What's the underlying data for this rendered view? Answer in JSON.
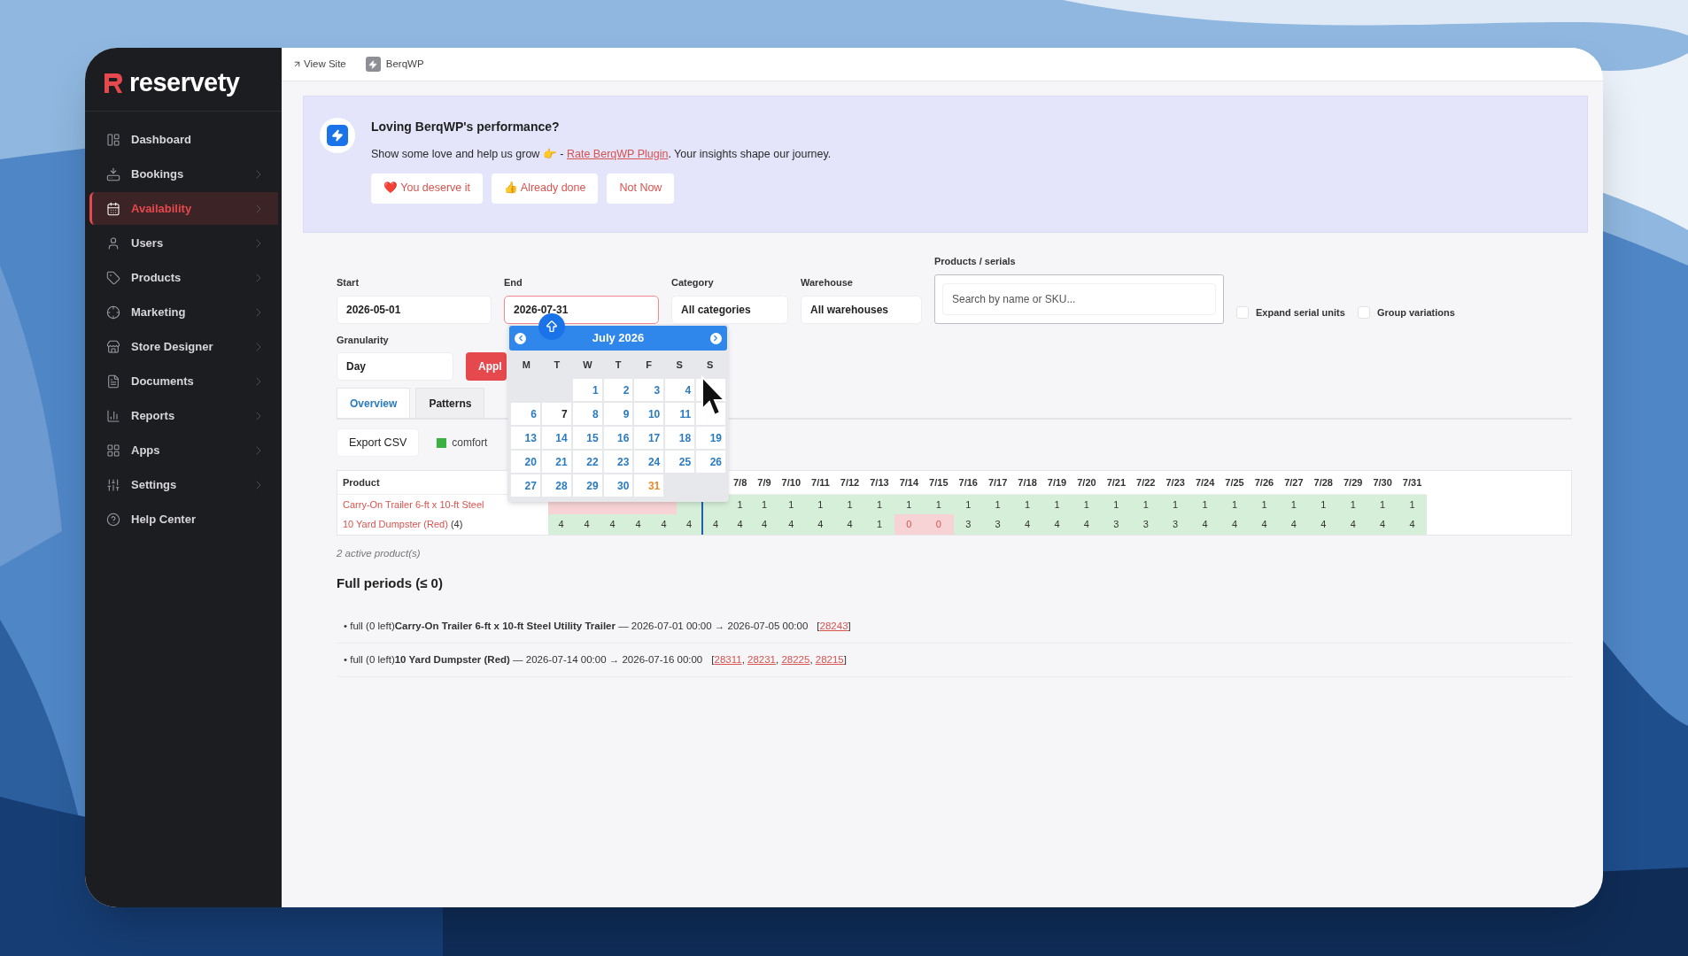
{
  "brand": {
    "name": "reservety"
  },
  "sidebar": {
    "items": [
      {
        "label": "Dashboard",
        "selected": false,
        "has_submenu": false
      },
      {
        "label": "Bookings",
        "selected": false,
        "has_submenu": true
      },
      {
        "label": "Availability",
        "selected": true,
        "has_submenu": true
      },
      {
        "label": "Users",
        "selected": false,
        "has_submenu": true
      },
      {
        "label": "Products",
        "selected": false,
        "has_submenu": true
      },
      {
        "label": "Marketing",
        "selected": false,
        "has_submenu": true
      },
      {
        "label": "Store Designer",
        "selected": false,
        "has_submenu": true
      },
      {
        "label": "Documents",
        "selected": false,
        "has_submenu": true
      },
      {
        "label": "Reports",
        "selected": false,
        "has_submenu": true
      },
      {
        "label": "Apps",
        "selected": false,
        "has_submenu": true
      },
      {
        "label": "Settings",
        "selected": false,
        "has_submenu": true
      },
      {
        "label": "Help Center",
        "selected": false,
        "has_submenu": false
      }
    ]
  },
  "topbar": {
    "links": [
      "View Site",
      "BerqWP"
    ]
  },
  "notice": {
    "title": "Loving BerqWP's performance?",
    "text_before": "Show some love and help us grow 👉 - ",
    "link": "Rate BerqWP Plugin",
    "text_after": ". Your insights shape our journey.",
    "buttons": [
      "❤️ You deserve it",
      "👍 Already done",
      "Not Now"
    ]
  },
  "filters": {
    "start": {
      "label": "Start",
      "value": "2026-05-01"
    },
    "end": {
      "label": "End",
      "value": "2026-07-31",
      "focused": true
    },
    "category": {
      "label": "Category",
      "value": "All categories"
    },
    "warehouse": {
      "label": "Warehouse",
      "value": "All warehouses"
    },
    "products": {
      "label": "Products / serials",
      "placeholder": "Search by name or SKU..."
    },
    "options": [
      {
        "label": "Expand serial units",
        "checked": false
      },
      {
        "label": "Group variations",
        "checked": false
      }
    ],
    "granularity": {
      "label": "Granularity",
      "value": "Day"
    },
    "apply": "Appl"
  },
  "tabs": [
    {
      "label": "Overview",
      "selected": true
    },
    {
      "label": "Patterns",
      "selected": false
    }
  ],
  "export": "Export CSV",
  "legend": [
    {
      "label": "comfort",
      "color": "#3cb043"
    }
  ],
  "table": {
    "product_header": "Product",
    "columns": [
      {
        "today": false
      },
      {
        "today": false
      },
      {
        "today": false
      },
      {
        "today": false
      },
      {
        "today": false
      },
      {
        "today": false
      },
      {
        "today": true
      },
      {
        "label": "7/8",
        "today": false
      },
      {
        "label": "7/9",
        "today": false
      },
      {
        "label": "7/10",
        "today": false
      },
      {
        "label": "7/11",
        "today": false
      },
      {
        "label": "7/12",
        "today": false
      },
      {
        "label": "7/13",
        "today": false
      },
      {
        "label": "7/14",
        "today": false
      },
      {
        "label": "7/15",
        "today": false
      },
      {
        "label": "7/16",
        "today": false
      },
      {
        "label": "7/17",
        "today": false
      },
      {
        "label": "7/18",
        "today": false
      },
      {
        "label": "7/19",
        "today": false
      },
      {
        "label": "7/20",
        "today": false
      },
      {
        "label": "7/21",
        "today": false
      },
      {
        "label": "7/22",
        "today": false
      },
      {
        "label": "7/23",
        "today": false
      },
      {
        "label": "7/24",
        "today": false
      },
      {
        "label": "7/25",
        "today": false
      },
      {
        "label": "7/26",
        "today": false
      },
      {
        "label": "7/27",
        "today": false
      },
      {
        "label": "7/28",
        "today": false
      },
      {
        "label": "7/29",
        "today": false
      },
      {
        "label": "7/30",
        "today": false
      },
      {
        "label": "7/31",
        "today": false
      }
    ],
    "rows": [
      {
        "name": "Carry-On Trailer 6-ft x 10-ft Steel",
        "cells": [
          {
            "full": true
          },
          {
            "full": true
          },
          {
            "full": true
          },
          {
            "full": true
          },
          {
            "full": true
          },
          {
            "full": false
          },
          {
            "full": false
          },
          {
            "value": "1",
            "full": false
          },
          {
            "value": "1",
            "full": false
          },
          {
            "value": "1",
            "full": false
          },
          {
            "value": "1",
            "full": false
          },
          {
            "value": "1",
            "full": false
          },
          {
            "value": "1",
            "full": false
          },
          {
            "value": "1",
            "full": false
          },
          {
            "value": "1",
            "full": false
          },
          {
            "value": "1",
            "full": false
          },
          {
            "value": "1",
            "full": false
          },
          {
            "value": "1",
            "full": false
          },
          {
            "value": "1",
            "full": false
          },
          {
            "value": "1",
            "full": false
          },
          {
            "value": "1",
            "full": false
          },
          {
            "value": "1",
            "full": false
          },
          {
            "value": "1",
            "full": false
          },
          {
            "value": "1",
            "full": false
          },
          {
            "value": "1",
            "full": false
          },
          {
            "value": "1",
            "full": false
          },
          {
            "value": "1",
            "full": false
          },
          {
            "value": "1",
            "full": false
          },
          {
            "value": "1",
            "full": false
          },
          {
            "value": "1",
            "full": false
          },
          {
            "value": "1",
            "full": false
          }
        ]
      },
      {
        "name": "10 Yard Dumpster (Red)",
        "count": "(4)",
        "cells": [
          {
            "value": "4",
            "full": false
          },
          {
            "value": "4",
            "full": false
          },
          {
            "value": "4",
            "full": false
          },
          {
            "value": "4",
            "full": false
          },
          {
            "value": "4",
            "full": false
          },
          {
            "value": "4",
            "full": false
          },
          {
            "value": "4",
            "full": false
          },
          {
            "value": "4",
            "full": false
          },
          {
            "value": "4",
            "full": false
          },
          {
            "value": "4",
            "full": false
          },
          {
            "value": "4",
            "full": false
          },
          {
            "value": "4",
            "full": false
          },
          {
            "value": "1",
            "full": false
          },
          {
            "value": "0",
            "full": true
          },
          {
            "value": "0",
            "full": true
          },
          {
            "value": "3",
            "full": false
          },
          {
            "value": "3",
            "full": false
          },
          {
            "value": "4",
            "full": false
          },
          {
            "value": "4",
            "full": false
          },
          {
            "value": "4",
            "full": false
          },
          {
            "value": "3",
            "full": false
          },
          {
            "value": "3",
            "full": false
          },
          {
            "value": "3",
            "full": false
          },
          {
            "value": "4",
            "full": false
          },
          {
            "value": "4",
            "full": false
          },
          {
            "value": "4",
            "full": false
          },
          {
            "value": "4",
            "full": false
          },
          {
            "value": "4",
            "full": false
          },
          {
            "value": "4",
            "full": false
          },
          {
            "value": "4",
            "full": false
          },
          {
            "value": "4",
            "full": false
          }
        ]
      }
    ]
  },
  "active_count": "2 active product(s)",
  "full_periods": {
    "title": "Full periods (≤ 0)",
    "open": "[",
    "close": "]",
    "separator": ", ",
    "entries": [
      {
        "text": "• full (0 left)**Carry-On Trailer 6-ft x 10-ft Steel Utility Trailer** — 2026-07-01 00:00 → 2026-07-05 00:00",
        "bookings": [
          "28243"
        ]
      },
      {
        "text": "• full (0 left)**10 Yard Dumpster (Red)** — 2026-07-14 00:00 → 2026-07-16 00:00",
        "bookings": [
          "28311",
          "28231",
          "28225",
          "28215"
        ]
      }
    ]
  },
  "datepicker": {
    "month": "July 2026",
    "weekdays": [
      "M",
      "T",
      "W",
      "T",
      "F",
      "S",
      "S"
    ],
    "weeks": [
      [
        {
          "kind": "empty"
        },
        {
          "kind": "empty"
        },
        {
          "day": "1",
          "kind": "normal"
        },
        {
          "day": "2",
          "kind": "normal"
        },
        {
          "day": "3",
          "kind": "normal"
        },
        {
          "day": "4",
          "kind": "normal"
        },
        {
          "kind": "covered"
        }
      ],
      [
        {
          "day": "6",
          "kind": "normal"
        },
        {
          "day": "7",
          "kind": "today"
        },
        {
          "day": "8",
          "kind": "normal"
        },
        {
          "day": "9",
          "kind": "normal"
        },
        {
          "day": "10",
          "kind": "normal"
        },
        {
          "day": "11",
          "kind": "normal"
        },
        {
          "kind": "covered"
        }
      ],
      [
        {
          "day": "13",
          "kind": "normal"
        },
        {
          "day": "14",
          "kind": "normal"
        },
        {
          "day": "15",
          "kind": "normal"
        },
        {
          "day": "16",
          "kind": "normal"
        },
        {
          "day": "17",
          "kind": "normal"
        },
        {
          "day": "18",
          "kind": "normal"
        },
        {
          "day": "19",
          "kind": "normal"
        }
      ],
      [
        {
          "day": "20",
          "kind": "normal"
        },
        {
          "day": "21",
          "kind": "normal"
        },
        {
          "day": "22",
          "kind": "normal"
        },
        {
          "day": "23",
          "kind": "normal"
        },
        {
          "day": "24",
          "kind": "normal"
        },
        {
          "day": "25",
          "kind": "normal"
        },
        {
          "day": "26",
          "kind": "normal"
        }
      ],
      [
        {
          "day": "27",
          "kind": "normal"
        },
        {
          "day": "28",
          "kind": "normal"
        },
        {
          "day": "29",
          "kind": "normal"
        },
        {
          "day": "30",
          "kind": "normal"
        },
        {
          "day": "31",
          "kind": "selected"
        },
        {
          "kind": "empty"
        },
        {
          "kind": "empty"
        }
      ]
    ]
  }
}
